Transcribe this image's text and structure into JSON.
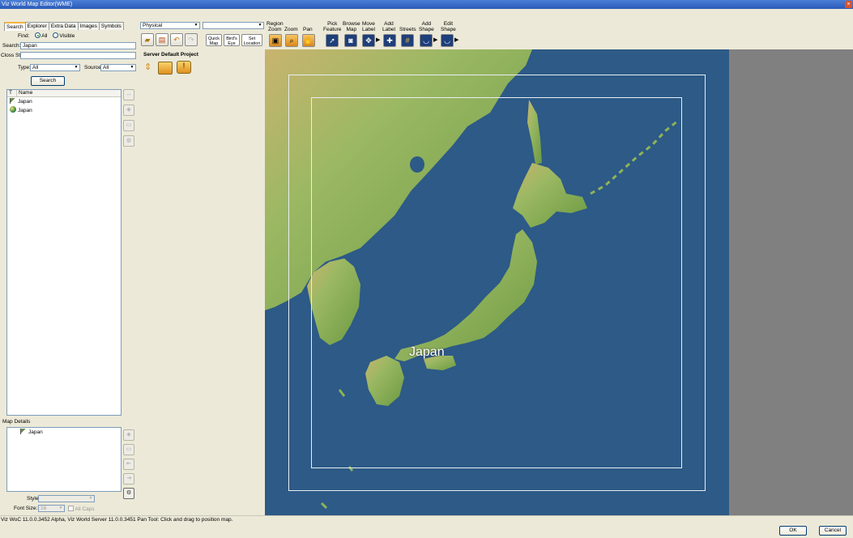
{
  "window": {
    "title": "Viz World Map Editor(WME)",
    "close_glyph": "×"
  },
  "tabs": [
    "Search",
    "Explorer",
    "Extra Data",
    "Images",
    "Symbols"
  ],
  "search": {
    "find_label": "Find:",
    "opt_all": "All",
    "opt_visible": "Visible",
    "search_label": "Search:",
    "search_value": "Japan",
    "cross_label": "Closs St:",
    "type_label": "Type:",
    "type_value": "All",
    "source_label": "Source:",
    "source_value": "All",
    "search_button": "Search"
  },
  "results": {
    "col_t": "T",
    "col_name": "Name",
    "items": [
      {
        "icon": "flag-icon",
        "name": "Japan"
      },
      {
        "icon": "globe-icon",
        "name": "Japan"
      }
    ]
  },
  "map_details": {
    "label": "Map Details",
    "items": [
      {
        "icon": "flag-icon",
        "name": "Japan"
      }
    ],
    "style_label": "Style:",
    "font_size_label": "Font Size:",
    "font_size_value": "16",
    "all_caps_label": "All Caps"
  },
  "toolbar": {
    "layer_value": "Physical",
    "second_value": "",
    "quick_map": [
      "Quick",
      "Map"
    ],
    "birds_eye": [
      "Bird's",
      "Eye"
    ],
    "set_location": [
      "Set",
      "Location"
    ],
    "region_zoom": [
      "Region",
      "Zoom"
    ],
    "zoom": "Zoom",
    "pan": "Pan",
    "pick_feature": [
      "Pick",
      "Feature"
    ],
    "browse_map": [
      "Browse",
      "Map"
    ],
    "move_label": [
      "Move",
      "Label"
    ],
    "add_label": [
      "Add",
      "Label"
    ],
    "streets": "Streets",
    "add_shape": [
      "Add",
      "Shape"
    ],
    "edit_shape": [
      "Edit",
      "Shape"
    ]
  },
  "project": {
    "title": "Server Default Project"
  },
  "map": {
    "label": "Japan"
  },
  "status": {
    "text": "Viz WoC 11.0.0.3452 Alpha, Viz World Server 11.0.0.3451 Pan Tool: Click and drag to position map."
  },
  "dialog": {
    "ok": "OK",
    "cancel": "Cancel"
  },
  "colors": {
    "sea": "#2d5a86",
    "land": "#8cae5a",
    "accent": "#f2b53f"
  }
}
